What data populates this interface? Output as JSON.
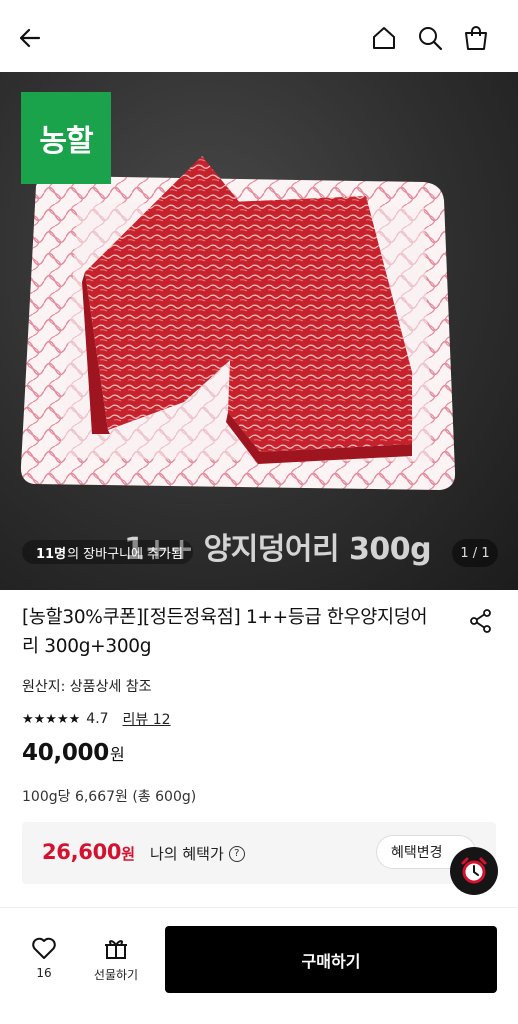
{
  "header": {
    "back_icon": "back-arrow-icon",
    "home_icon": "home-icon",
    "search_icon": "search-icon",
    "cart_icon": "shopping-bag-icon"
  },
  "gallery": {
    "badge_text": "농할",
    "image_caption": "1++ 양지덩어리 300g",
    "cart_count_strong": "11명",
    "cart_count_text": "의 장바구니에 추가됨",
    "image_counter": "1 / 1",
    "badge_color": "#1aa34a"
  },
  "product": {
    "title": "[농할30%쿠폰][정든정육점] 1++등급 한우양지덩어리 300g+300g",
    "origin": "원산지: 상품상세 참조",
    "stars": "★★★★★",
    "rating": "4.7",
    "review_label": "리뷰 12",
    "price_value": "40,000",
    "price_currency": "원",
    "unit_price": "100g당 6,667원 (총 600g)"
  },
  "benefit": {
    "price_value": "26,600",
    "price_currency": "원",
    "label": "나의 혜택가",
    "help_icon": "question-circle-icon",
    "change_label": "혜택변경",
    "accent_color": "#d3122f"
  },
  "bottom_bar": {
    "like_count": "16",
    "gift_label": "선물하기",
    "buy_label": "구매하기"
  }
}
